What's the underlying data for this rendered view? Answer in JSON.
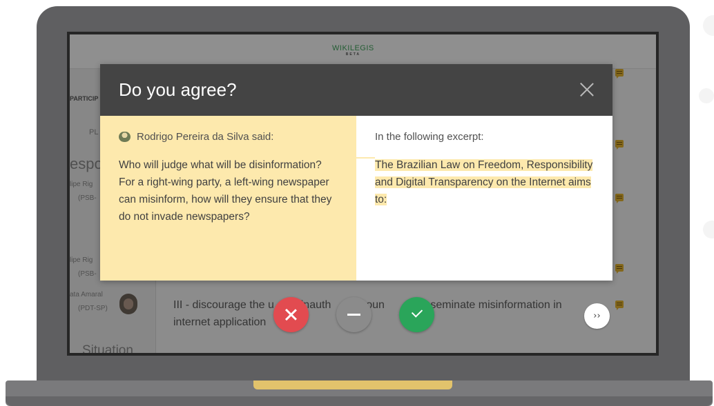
{
  "app": {
    "logo": "WIKILEGIS",
    "logo_badge": "BETA"
  },
  "background": {
    "sidebar_labels": [
      "PARTICIP",
      "PL",
      "espo",
      "lipe Rig",
      "(PSB-",
      "lipe Rig",
      "(PSB-",
      "ata Amaral",
      "(PDT-SP)",
      "Situation"
    ],
    "main_text_line1": "III - discourage the u",
    "main_text_line1_mid": "f inauth",
    "main_text_line1_mid2": "accoun",
    "main_text_line1_end": "disseminate misinformation in",
    "main_text_line2": "internet application"
  },
  "modal": {
    "title": "Do you agree?",
    "author_line": "Rodrigo Pereira da Silva said:",
    "comment": "Who will judge what will be disinformation? For a right-wing party, a left-wing newspaper can misinform, how will they ensure that they do not invade newspapers?",
    "excerpt_label": "In the following excerpt:",
    "excerpt": "The Brazilian Law on Freedom, Responsibility and Digital Transparency on the Internet aims to:"
  },
  "controls": {
    "next_label": "››"
  },
  "colors": {
    "accent_yellow": "#fde9ad",
    "disagree": "#e24b50",
    "neutral": "#8b8b8b",
    "agree": "#2aa55a",
    "header": "#444444"
  }
}
